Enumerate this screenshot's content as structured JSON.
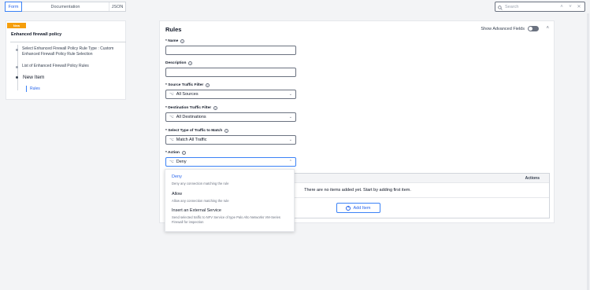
{
  "tabs": {
    "form": "Form",
    "documentation": "Documentation",
    "json": "JSON"
  },
  "search": {
    "placeholder": "Search"
  },
  "sidebar": {
    "badge": "New",
    "title": "Enhanced firewall policy",
    "items": [
      "Select Enhanced Firewall Policy Rule Type : Custom Enhanced Firewall Policy Rule Selection",
      "List of Enhanced Firewall Policy Rules"
    ],
    "new_item": "New Item",
    "rules": "Rules"
  },
  "main": {
    "title": "Rules",
    "advanced_fields": "Show Advanced Fields",
    "fields": {
      "name_label": "* Name",
      "description_label": "Description",
      "source_label": "* Source Traffic Filter",
      "source_value": "All Sources",
      "dest_label": "* Destination Traffic Filter",
      "dest_value": "All Destinations",
      "traffic_label": "* Select Type of Traffic to Match",
      "traffic_value": "Match All Traffic",
      "action_label": "* Action",
      "action_value": "Deny"
    },
    "table": {
      "actions_header": "Actions",
      "empty": "There are no items added yet. Start by adding first item.",
      "add": "Add Item"
    }
  },
  "dropdown": {
    "options": [
      {
        "title": "Deny",
        "desc": "Deny any connection matching the rule"
      },
      {
        "title": "Allow",
        "desc": "Allow any connection matching the rule"
      },
      {
        "title": "Insert an External Service",
        "desc": "Send selected traffic to NFV Service of type Palo Alto Networks VM-Series Firewall for inspection"
      }
    ]
  },
  "colors": {
    "accent": "#2563eb",
    "badge": "#f59e0b"
  }
}
